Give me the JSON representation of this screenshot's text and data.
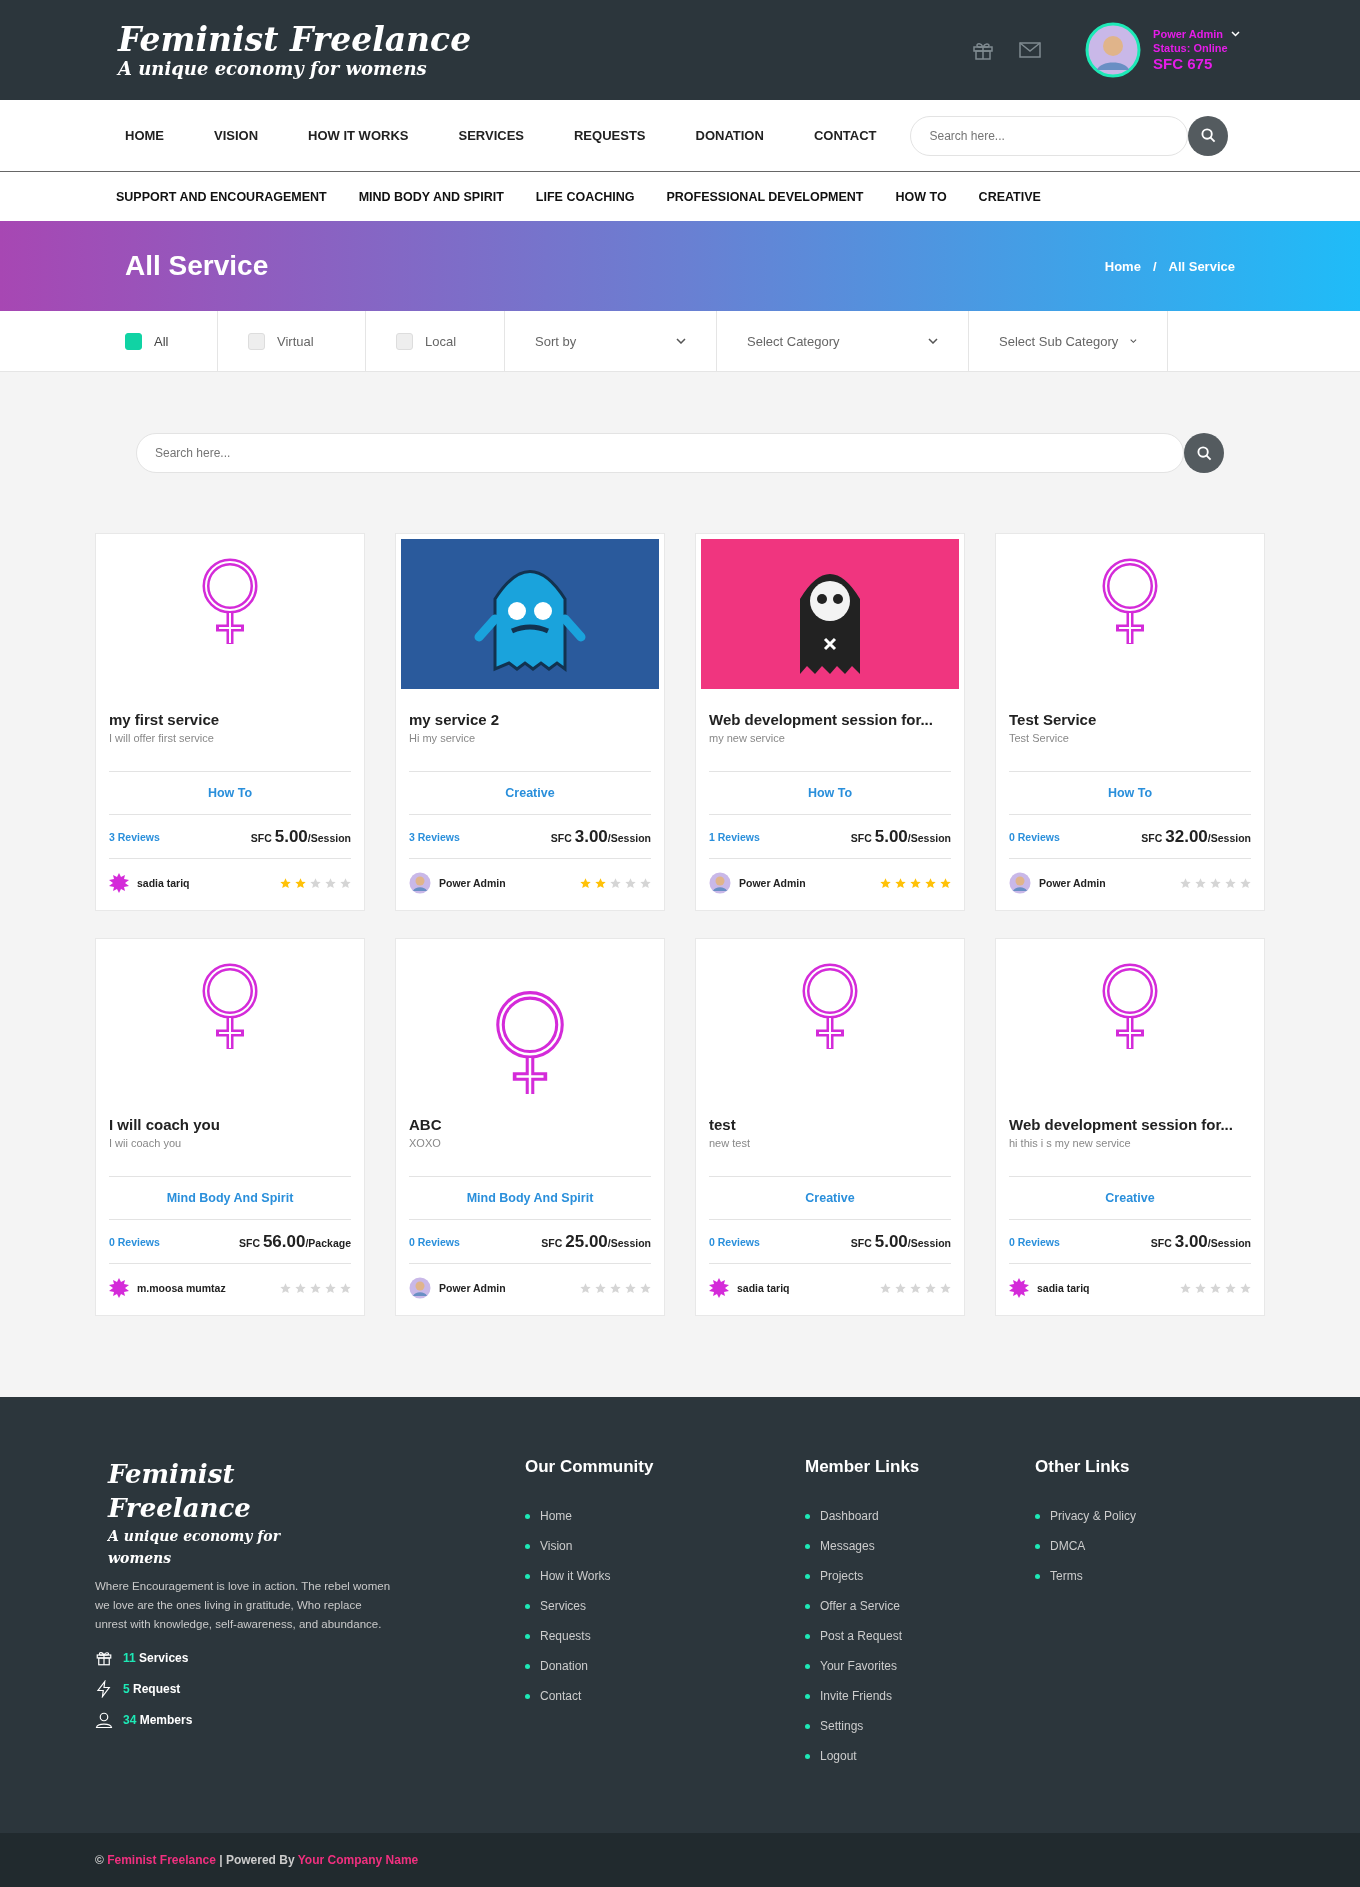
{
  "header": {
    "logo_title": "Feminist Freelance",
    "logo_tagline": "A unique economy for womens",
    "user": {
      "name": "Power Admin",
      "status": "Status: Online",
      "balance": "SFC 675"
    }
  },
  "nav": {
    "items": [
      "HOME",
      "VISION",
      "HOW IT WORKS",
      "SERVICES",
      "REQUESTS",
      "DONATION",
      "CONTACT"
    ],
    "search": {
      "placeholder": "Search here..."
    }
  },
  "categories": [
    "SUPPORT AND ENCOURAGEMENT",
    "MIND BODY AND SPIRIT",
    "LIFE COACHING",
    "PROFESSIONAL DEVELOPMENT",
    "HOW TO",
    "CREATIVE"
  ],
  "banner": {
    "title": "All Service",
    "breadcrumb": [
      "Home",
      "/",
      "All Service"
    ]
  },
  "filters": {
    "checks": [
      {
        "label": "All",
        "checked": true
      },
      {
        "label": "Virtual",
        "checked": false
      },
      {
        "label": "Local",
        "checked": false
      }
    ],
    "dropdowns": [
      "Sort by",
      "Select Category",
      "Select Sub Category"
    ]
  },
  "search": {
    "placeholder": "Search here..."
  },
  "cards": [
    {
      "kind": "symbol",
      "title": "my first service",
      "subtitle": "I will offer first service",
      "category": "How To",
      "reviews": "3 Reviews",
      "currency": "SFC",
      "price": "5.00",
      "unit": "/Session",
      "author": "sadia tariq",
      "avatar": {
        "kind": "flower"
      },
      "stars": 2
    },
    {
      "kind": "picture",
      "title": "my service 2",
      "subtitle": "Hi my service",
      "category": "Creative",
      "reviews": "3 Reviews",
      "currency": "SFC",
      "price": "3.00",
      "unit": "/Session",
      "author": "Power Admin",
      "avatar": {
        "kind": "admin"
      },
      "stars": 2
    },
    {
      "kind": "picture",
      "title": "Web development session for...",
      "subtitle": "my new service",
      "category": "How To",
      "reviews": "1 Reviews",
      "currency": "SFC",
      "price": "5.00",
      "unit": "/Session",
      "author": "Power Admin",
      "avatar": {
        "kind": "admin"
      },
      "stars": 5
    },
    {
      "kind": "symbol",
      "title": "Test Service",
      "subtitle": "Test Service",
      "category": "How To",
      "reviews": "0 Reviews",
      "currency": "SFC",
      "price": "32.00",
      "unit": "/Session",
      "author": "Power Admin",
      "avatar": {
        "kind": "admin"
      },
      "stars": 0
    },
    {
      "kind": "symbol",
      "title": "I will coach you",
      "subtitle": "I wii coach you",
      "category": "Mind Body And Spirit",
      "reviews": "0 Reviews",
      "currency": "SFC",
      "price": "56.00",
      "unit": "/Package",
      "author": "m.moosa mumtaz",
      "avatar": {
        "kind": "flower"
      },
      "stars": 0
    },
    {
      "kind": "large",
      "title": "ABC",
      "subtitle": "XOXO",
      "category": "Mind Body And Spirit",
      "reviews": "0 Reviews",
      "currency": "SFC",
      "price": "25.00",
      "unit": "/Session",
      "author": "Power Admin",
      "avatar": {
        "kind": "admin"
      },
      "stars": 0
    },
    {
      "kind": "symbol",
      "title": "test",
      "subtitle": "new test",
      "category": "Creative",
      "reviews": "0 Reviews",
      "currency": "SFC",
      "price": "5.00",
      "unit": "/Session",
      "author": "sadia tariq",
      "avatar": {
        "kind": "flower"
      },
      "stars": 0
    },
    {
      "kind": "symbol",
      "title": "Web development session for...",
      "subtitle": "hi this i s my new service",
      "category": "Creative",
      "reviews": "0 Reviews",
      "currency": "SFC",
      "price": "3.00",
      "unit": "/Session",
      "author": "sadia tariq",
      "avatar": {
        "kind": "flower"
      },
      "stars": 0
    }
  ],
  "footer": {
    "logo_title": "Feminist Freelance",
    "logo_tagline": "A unique economy for womens",
    "about": "Where Encouragement is love in action. The rebel women we love are the ones living in gratitude, Who replace unrest with knowledge, self-awareness, and abundance.",
    "stats": [
      {
        "kind": "gift",
        "count": "11",
        "label": "Services"
      },
      {
        "kind": "bolt",
        "count": "5",
        "label": "Request"
      },
      {
        "kind": "user",
        "count": "34",
        "label": "Members"
      }
    ],
    "columns": [
      {
        "title": "Our Community",
        "links": [
          "Home",
          "Vision",
          "How it Works",
          "Services",
          "Requests",
          "Donation",
          "Contact"
        ]
      },
      {
        "title": "Member Links",
        "links": [
          "Dashboard",
          "Messages",
          "Projects",
          "Offer a Service",
          "Post a Request",
          "Your Favorites",
          "Invite Friends",
          "Settings",
          "Logout"
        ]
      },
      {
        "title": "Other Links",
        "links": [
          "Privacy & Policy",
          "DMCA",
          "Terms"
        ]
      }
    ]
  },
  "copyright": {
    "symbol": "©",
    "brand": "Feminist Freelance",
    "separator": "| Powered By",
    "company": "Your Company Name"
  }
}
